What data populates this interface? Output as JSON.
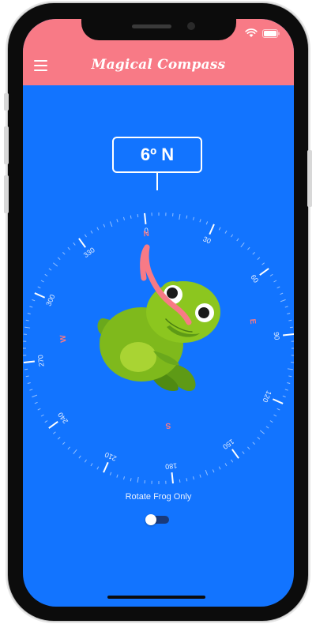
{
  "app": {
    "title": "Magical Compass"
  },
  "compass": {
    "heading_label": "6º N",
    "heading_degrees": 6,
    "degree_labels": [
      "0",
      "30",
      "60",
      "90",
      "120",
      "150",
      "180",
      "210",
      "240",
      "270",
      "300",
      "330"
    ],
    "cardinals": {
      "north": "N",
      "east": "E",
      "south": "S",
      "west": "W"
    }
  },
  "settings": {
    "rotate_frog_label": "Rotate Frog Only",
    "rotate_frog_enabled": false
  },
  "icons": {
    "menu": "hamburger-menu-icon",
    "wifi": "wifi-icon",
    "battery": "battery-icon",
    "mascot": "frog-icon"
  },
  "colors": {
    "screen_background": "#1274ff",
    "header": "#f87a86",
    "cardinal": "#f87a86",
    "frog_green": "#84c11d"
  }
}
